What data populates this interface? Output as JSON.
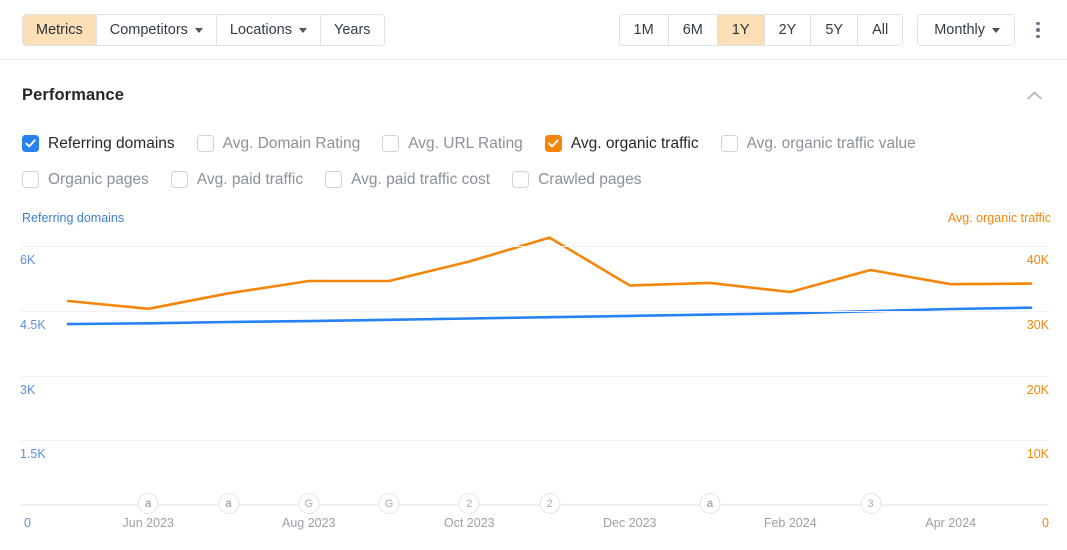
{
  "toolbar": {
    "nav_tabs": [
      {
        "label": "Metrics",
        "active": true,
        "caret": false
      },
      {
        "label": "Competitors",
        "active": false,
        "caret": true
      },
      {
        "label": "Locations",
        "active": false,
        "caret": true
      },
      {
        "label": "Years",
        "active": false,
        "caret": false
      }
    ],
    "ranges": [
      {
        "label": "1M",
        "active": false
      },
      {
        "label": "6M",
        "active": false
      },
      {
        "label": "1Y",
        "active": true
      },
      {
        "label": "2Y",
        "active": false
      },
      {
        "label": "5Y",
        "active": false
      },
      {
        "label": "All",
        "active": false
      }
    ],
    "granularity": {
      "label": "Monthly",
      "caret": true
    },
    "more_menu_icon": "kebab-menu-icon"
  },
  "panel": {
    "title": "Performance",
    "collapse_icon": "chevron-up-icon"
  },
  "metrics": {
    "row1": [
      {
        "label": "Referring domains",
        "checked": true,
        "color": "#2681f2"
      },
      {
        "label": "Avg. Domain Rating",
        "checked": false,
        "color": ""
      },
      {
        "label": "Avg. URL Rating",
        "checked": false,
        "color": ""
      },
      {
        "label": "Avg. organic traffic",
        "checked": true,
        "color": "#f4860a"
      },
      {
        "label": "Avg. organic traffic value",
        "checked": false,
        "color": ""
      }
    ],
    "row2": [
      {
        "label": "Organic pages",
        "checked": false,
        "color": ""
      },
      {
        "label": "Avg. paid traffic",
        "checked": false,
        "color": ""
      },
      {
        "label": "Avg. paid traffic cost",
        "checked": false,
        "color": ""
      },
      {
        "label": "Crawled pages",
        "checked": false,
        "color": ""
      }
    ]
  },
  "chart_data": {
    "type": "line",
    "title": "Performance",
    "xlabel": "",
    "grid": true,
    "legend": "none",
    "left_axis": {
      "name": "Referring domains",
      "color": "#2681f2",
      "ticks": [
        "6K",
        "4.5K",
        "3K",
        "1.5K",
        "0"
      ],
      "tick_values": [
        6000,
        4500,
        3000,
        1500,
        0
      ],
      "ylim": [
        0,
        6000
      ]
    },
    "right_axis": {
      "name": "Avg. organic traffic",
      "color": "#f4860a",
      "ticks": [
        "40K",
        "30K",
        "20K",
        "10K",
        "0"
      ],
      "tick_values": [
        40000,
        30000,
        20000,
        10000,
        0
      ],
      "ylim": [
        0,
        40000
      ]
    },
    "x": [
      "May 2023",
      "Jun 2023",
      "Jul 2023",
      "Aug 2023",
      "Sep 2023",
      "Oct 2023",
      "Nov 2023",
      "Dec 2023",
      "Jan 2024",
      "Feb 2024",
      "Mar 2024",
      "Apr 2024",
      "May 2024"
    ],
    "xtick_labels": [
      "Jun 2023",
      "Aug 2023",
      "Oct 2023",
      "Dec 2023",
      "Feb 2024",
      "Apr 2024"
    ],
    "xtick_positions": [
      1,
      3,
      5,
      7,
      9,
      11
    ],
    "series": [
      {
        "name": "Referring domains",
        "axis": "left",
        "color": "#2681f2",
        "values": [
          4190,
          4210,
          4240,
          4260,
          4290,
          4320,
          4350,
          4380,
          4410,
          4440,
          4490,
          4540,
          4570
        ]
      },
      {
        "name": "Avg. organic traffic",
        "axis": "right",
        "color": "#f4860a",
        "values": [
          31500,
          30300,
          32700,
          34600,
          34600,
          37600,
          41300,
          33900,
          34300,
          32900,
          36300,
          34100,
          34200
        ]
      }
    ],
    "events": [
      {
        "label": "a",
        "x_index": 1,
        "type": "algo-update"
      },
      {
        "label": "a",
        "x_index": 2,
        "type": "algo-update"
      },
      {
        "label": "G",
        "x_index": 3,
        "type": "google-update"
      },
      {
        "label": "G",
        "x_index": 4,
        "type": "google-update"
      },
      {
        "label": "2",
        "x_index": 5,
        "type": "multi-update"
      },
      {
        "label": "2",
        "x_index": 6,
        "type": "multi-update"
      },
      {
        "label": "a",
        "x_index": 8,
        "type": "algo-update"
      },
      {
        "label": "3",
        "x_index": 10,
        "type": "multi-update"
      }
    ],
    "edge_labels": {
      "left": "0",
      "right": "0"
    }
  }
}
